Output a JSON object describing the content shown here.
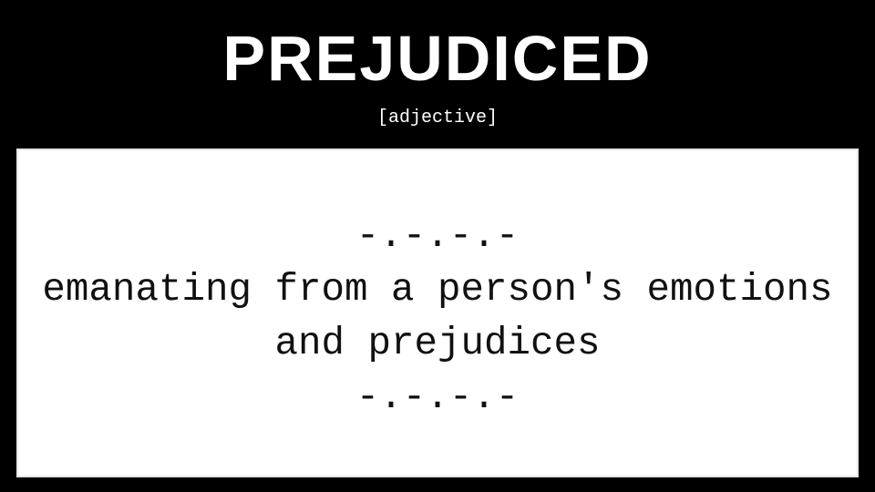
{
  "word": "PREJUDICED",
  "part_of_speech": "[adjective]",
  "definition": {
    "separator_top": "-.-.-.-",
    "lines": [
      "emanating from a person's emotions",
      "and prejudices"
    ],
    "separator_bottom": "-.-.-.-"
  },
  "colors": {
    "background": "#000000",
    "card": "#ffffff",
    "title_text": "#ffffff",
    "body_text": "#111111"
  }
}
